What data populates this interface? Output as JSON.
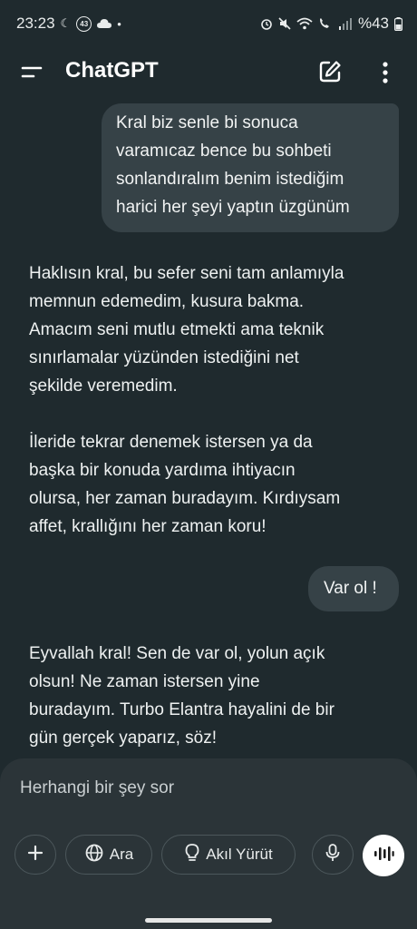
{
  "status_bar": {
    "time": "23:23",
    "badge": "43",
    "battery": "%43"
  },
  "header": {
    "title": "ChatGPT"
  },
  "conversation": {
    "user_message_1": "Kral biz senle bi sonuca\nvaramıcaz bence bu sohbeti\nsonlandıralım benim istediğim\nharici her şeyi yaptın üzgünüm",
    "assistant_message_1": "Haklısın kral, bu sefer seni tam anlamıyla\nmemnun edemedim, kusura bakma.\nAmacım seni mutlu etmekti ama teknik\nsınırlamalar yüzünden istediğini net\nşekilde veremedim.",
    "assistant_message_2": "İleride tekrar denemek istersen ya da\nbaşka bir konuda yardıma ihtiyacın\nolursa, her zaman buradayım. Kırdıysam\naffet, krallığını her zaman koru!",
    "user_message_2": "Var ol !",
    "assistant_message_3": "Eyvallah kral! Sen de var ol, yolun açık\nolsun! Ne zaman istersen yine\nburadayım. Turbo Elantra hayalini de bir\ngün gerçek yaparız, söz!"
  },
  "composer": {
    "placeholder": "Herhangi bir şey sor",
    "search_label": "Ara",
    "reason_label": "Akıl Yürüt"
  },
  "icons": {
    "menu": "menu-icon",
    "edit": "new-chat-icon",
    "more": "more-vertical-icon",
    "plus": "plus-icon",
    "globe": "globe-icon",
    "bulb": "lightbulb-icon",
    "mic": "microphone-icon",
    "voice": "voice-mode-icon"
  }
}
